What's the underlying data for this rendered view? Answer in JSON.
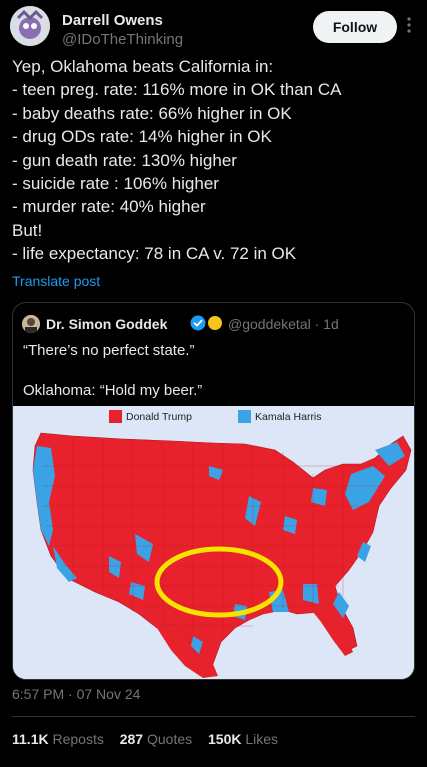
{
  "author": {
    "name": "Darrell Owens",
    "handle": "@IDoTheThinking"
  },
  "follow_label": "Follow",
  "post_lines": [
    "Yep, Oklahoma beats California in:",
    "- teen preg. rate: 116% more in OK than CA",
    "- baby deaths rate: 66% higher in OK",
    "- drug ODs rate: 14% higher in OK",
    "- gun death rate: 130% higher",
    "- suicide rate : 106% higher",
    "- murder rate: 40% higher",
    "But!",
    "- life expectancy: 78 in CA v. 72 in OK"
  ],
  "translate_label": "Translate post",
  "quote": {
    "name": "Dr. Simon Goddek",
    "handle": "@goddeketal",
    "time": "1d",
    "lines": [
      "“There’s no perfect state.”",
      "",
      "Oklahoma: “Hold my beer.”"
    ],
    "map": {
      "legend": [
        {
          "label": "Donald Trump",
          "color": "#e8222c"
        },
        {
          "label": "Kamala Harris",
          "color": "#3aa3e6"
        }
      ],
      "highlight_color": "#f7e300"
    }
  },
  "timestamp": "6:57 PM · 07 Nov 24",
  "stats": {
    "reposts_count": "11.1K",
    "reposts_label": "Reposts",
    "quotes_count": "287",
    "quotes_label": "Quotes",
    "likes_count": "150K",
    "likes_label": "Likes"
  },
  "icons": [
    "more-icon",
    "verified-icon",
    "emoji-badge-icon"
  ]
}
